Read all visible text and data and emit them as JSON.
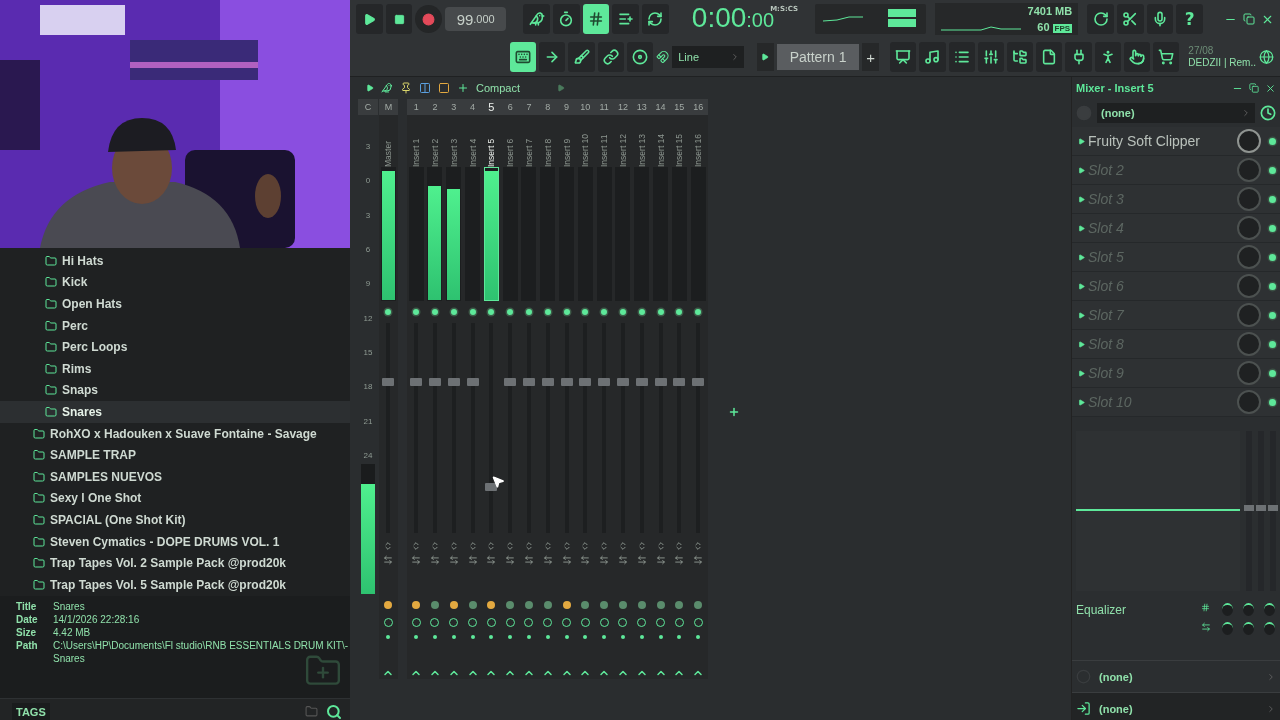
{
  "browser": {
    "subfolders": [
      {
        "label": "Hi Hats",
        "selected": false
      },
      {
        "label": "Kick",
        "selected": false
      },
      {
        "label": "Open Hats",
        "selected": false
      },
      {
        "label": "Perc",
        "selected": false
      },
      {
        "label": "Perc Loops",
        "selected": false
      },
      {
        "label": "Rims",
        "selected": false
      },
      {
        "label": "Snaps",
        "selected": false
      },
      {
        "label": "Snares",
        "selected": true
      }
    ],
    "folders": [
      {
        "label": "RohXO x Hadouken x Suave Fontaine - Savage",
        "selected": false
      },
      {
        "label": "SAMPLE TRAP",
        "selected": false
      },
      {
        "label": "SAMPLES NUEVOS",
        "selected": false
      },
      {
        "label": "Sexy l One Shot",
        "selected": false
      },
      {
        "label": "SPACIAL (One Shot Kit)",
        "selected": false
      },
      {
        "label": "Steven Cymatics - DOPE DRUMS VOL. 1",
        "selected": false
      },
      {
        "label": "Trap Tapes Vol. 2 Sample Pack @prod20k",
        "selected": false
      },
      {
        "label": "Trap Tapes Vol. 5 Sample Pack @prod20k",
        "selected": false
      }
    ]
  },
  "info": {
    "fields": [
      {
        "label": "Title",
        "lines": [
          "Snares"
        ]
      },
      {
        "label": "Date",
        "lines": [
          "14/1/2026 22:28:16"
        ]
      },
      {
        "label": "Size",
        "lines": [
          "4.42 MB"
        ]
      },
      {
        "label": "Path",
        "lines": [
          "C:\\Users\\HP\\Documents\\Fl studio\\RNB ESSENTIALS DRUM KIT\\-",
          "Snares"
        ]
      }
    ]
  },
  "tags": {
    "label": "TAGS"
  },
  "toolbar": {
    "tempo": "99",
    "tempo_fraction": ".000",
    "record": {
      "on": true
    },
    "row1_buttons": [
      {
        "kind": "typing",
        "on": false
      },
      {
        "kind": "countdown",
        "on": false
      },
      {
        "kind": "step",
        "on": true
      },
      {
        "kind": "overdub",
        "on": false
      },
      {
        "kind": "loop",
        "on": false
      }
    ],
    "time": "0:00",
    "time_cs": ":00",
    "time_format": "M:S:CS",
    "cpu": "7",
    "memory": "401 MB",
    "fps": "60",
    "fps_unit": "FPS",
    "tool_buttons": [
      {
        "kind": "undo",
        "on": false
      },
      {
        "kind": "cut",
        "on": false
      },
      {
        "kind": "mic",
        "on": false
      },
      {
        "kind": "help",
        "on": false,
        "glyph": "?"
      }
    ],
    "row2_buttons": [
      {
        "kind": "pattern_mode",
        "on": true
      },
      {
        "kind": "arrow",
        "on": false
      },
      {
        "kind": "brush",
        "on": false
      },
      {
        "kind": "link",
        "on": false
      },
      {
        "kind": "knob",
        "on": false
      }
    ],
    "snap": "Line",
    "pattern": "Pattern 1",
    "add": "+",
    "window_buttons": [
      {
        "kind": "playlist",
        "on": false
      },
      {
        "kind": "piano_roll",
        "on": false
      },
      {
        "kind": "channel_rack",
        "on": false
      },
      {
        "kind": "mixer",
        "on": false
      },
      {
        "kind": "browser",
        "on": false
      },
      {
        "kind": "file",
        "on": false
      },
      {
        "kind": "plugin",
        "on": false
      },
      {
        "kind": "figure",
        "on": false
      },
      {
        "kind": "hint",
        "on": false
      },
      {
        "kind": "cart",
        "on": false
      }
    ],
    "date": "27/08",
    "user": "DEDZII | Rem.."
  },
  "mixer": {
    "view": "Compact",
    "scale_header": "C",
    "scale": [
      "3",
      "0",
      "3",
      "6",
      "9",
      "12",
      "15",
      "18",
      "21",
      "24"
    ],
    "output_meter": {
      "level": 0.85
    },
    "tracks": [
      {
        "name": "Master",
        "number": "M",
        "selected": false,
        "meter": {
          "level": 0.98
        },
        "fader": {
          "level": 0.72
        },
        "send": true
      },
      {
        "name": "Insert 1",
        "number": "1",
        "selected": false,
        "fader": {
          "level": 0.72
        },
        "send": true
      },
      {
        "name": "Insert 2",
        "number": "2",
        "selected": false,
        "meter": {
          "level": 0.86
        },
        "fader": {
          "level": 0.72
        },
        "send": false
      },
      {
        "name": "Insert 3",
        "number": "3",
        "selected": false,
        "meter": {
          "level": 0.84
        },
        "fader": {
          "level": 0.72
        },
        "send": true
      },
      {
        "name": "Insert 4",
        "number": "4",
        "selected": false,
        "fader": {
          "level": 0.72
        },
        "send": false
      },
      {
        "name": "Insert 5",
        "number": "5",
        "selected": true,
        "meter": {
          "level": 0.98
        },
        "fader": {
          "level": 0.22
        },
        "send": true
      },
      {
        "name": "Insert 6",
        "number": "6",
        "selected": false,
        "fader": {
          "level": 0.72
        },
        "send": false
      },
      {
        "name": "Insert 7",
        "number": "7",
        "selected": false,
        "fader": {
          "level": 0.72
        },
        "send": false
      },
      {
        "name": "Insert 8",
        "number": "8",
        "selected": false,
        "fader": {
          "level": 0.72
        },
        "send": false
      },
      {
        "name": "Insert 9",
        "number": "9",
        "selected": false,
        "fader": {
          "level": 0.72
        },
        "send": true
      },
      {
        "name": "Insert 10",
        "number": "10",
        "selected": false,
        "fader": {
          "level": 0.72
        },
        "send": false
      },
      {
        "name": "Insert 11",
        "number": "11",
        "selected": false,
        "fader": {
          "level": 0.72
        },
        "send": false
      },
      {
        "name": "Insert 12",
        "number": "12",
        "selected": false,
        "fader": {
          "level": 0.72
        },
        "send": false
      },
      {
        "name": "Insert 13",
        "number": "13",
        "selected": false,
        "fader": {
          "level": 0.72
        },
        "send": false
      },
      {
        "name": "Insert 14",
        "number": "14",
        "selected": false,
        "fader": {
          "level": 0.72
        },
        "send": false
      },
      {
        "name": "Insert 15",
        "number": "15",
        "selected": false,
        "fader": {
          "level": 0.72
        },
        "send": false
      },
      {
        "name": "Insert 16",
        "number": "16",
        "selected": false,
        "fader": {
          "level": 0.72
        },
        "send": false
      }
    ]
  },
  "insert": {
    "title": "Mixer - Insert 5",
    "preset": "(none)",
    "slots": [
      {
        "label": "Fruity Soft Clipper",
        "kind": "plugin",
        "on": true
      },
      {
        "label": "Slot 2",
        "kind": "empty",
        "on": true
      },
      {
        "label": "Slot 3",
        "kind": "empty",
        "on": true
      },
      {
        "label": "Slot 4",
        "kind": "empty",
        "on": true
      },
      {
        "label": "Slot 5",
        "kind": "empty",
        "on": true
      },
      {
        "label": "Slot 6",
        "kind": "empty",
        "on": true
      },
      {
        "label": "Slot 7",
        "kind": "empty",
        "on": true
      },
      {
        "label": "Slot 8",
        "kind": "empty",
        "on": true
      },
      {
        "label": "Slot 9",
        "kind": "empty",
        "on": true
      },
      {
        "label": "Slot 10",
        "kind": "empty",
        "on": true
      }
    ],
    "eq_label": "Equalizer",
    "routing": [
      {
        "label": "(none)",
        "kind": "input"
      },
      {
        "label": "(none)",
        "kind": "output"
      }
    ]
  }
}
